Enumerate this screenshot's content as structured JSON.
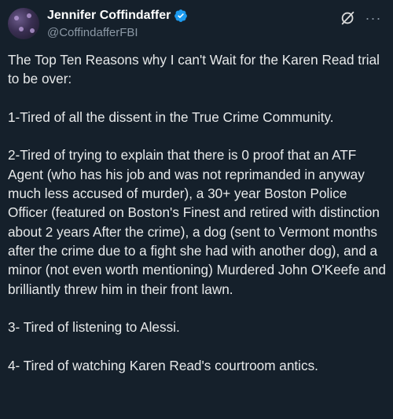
{
  "author": {
    "display_name": "Jennifer Coffindaffer",
    "handle": "@CoffindafferFBI",
    "verified_icon": "verified-badge-icon",
    "avatar_icon": "avatar"
  },
  "actions": {
    "grok_icon": "grok-icon",
    "more_icon": "more-dots-icon",
    "more_glyph": "···"
  },
  "tweet": {
    "paragraphs": [
      "The Top Ten Reasons why I can't Wait for the Karen Read trial to be over:",
      "1-Tired of all the dissent in the True Crime Community.",
      "2-Tired of trying to explain that there is 0 proof that an ATF Agent (who has his job and was not reprimanded in anyway much less accused of murder), a 30+ year Boston Police Officer (featured on Boston's Finest and retired with distinction about 2 years After the crime), a dog (sent to Vermont months after the crime due to a fight she had with another dog), and a minor (not even worth mentioning) Murdered John O'Keefe and brilliantly threw him in their front lawn.",
      "3- Tired of listening to Alessi.",
      "4- Tired of watching Karen Read's courtroom antics."
    ]
  },
  "colors": {
    "background": "#15202b",
    "text": "#e7e9ea",
    "secondary": "#8b98a5",
    "verified": "#1d9bf0"
  }
}
